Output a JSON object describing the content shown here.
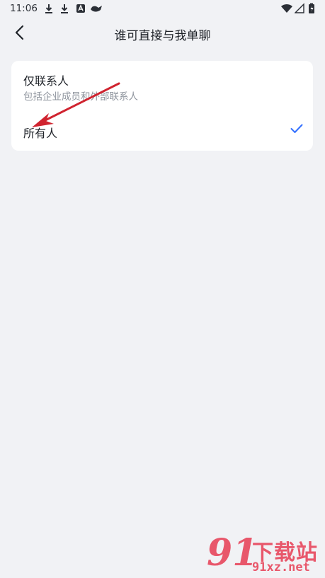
{
  "status_bar": {
    "time": "11:06",
    "icons": [
      "download-icon",
      "download-icon",
      "app-notification-icon",
      "bird-app-icon",
      "wifi-icon",
      "cellular-signal-icon",
      "battery-charging-icon"
    ]
  },
  "nav": {
    "title": "谁可直接与我单聊",
    "back_icon": "chevron-left-icon"
  },
  "options": [
    {
      "title": "仅联系人",
      "description": "包括企业成员和外部联系人",
      "selected": false
    },
    {
      "title": "所有人",
      "selected": true,
      "check_icon": "checkmark-icon"
    }
  ],
  "colors": {
    "background": "#f1f2f5",
    "card": "#ffffff",
    "check": "#3370ff",
    "annotation_arrow": "#d0232f",
    "watermark": "#e8475d"
  },
  "watermark": {
    "logo": "91",
    "text": "下载站",
    "url": "91xz.net"
  }
}
